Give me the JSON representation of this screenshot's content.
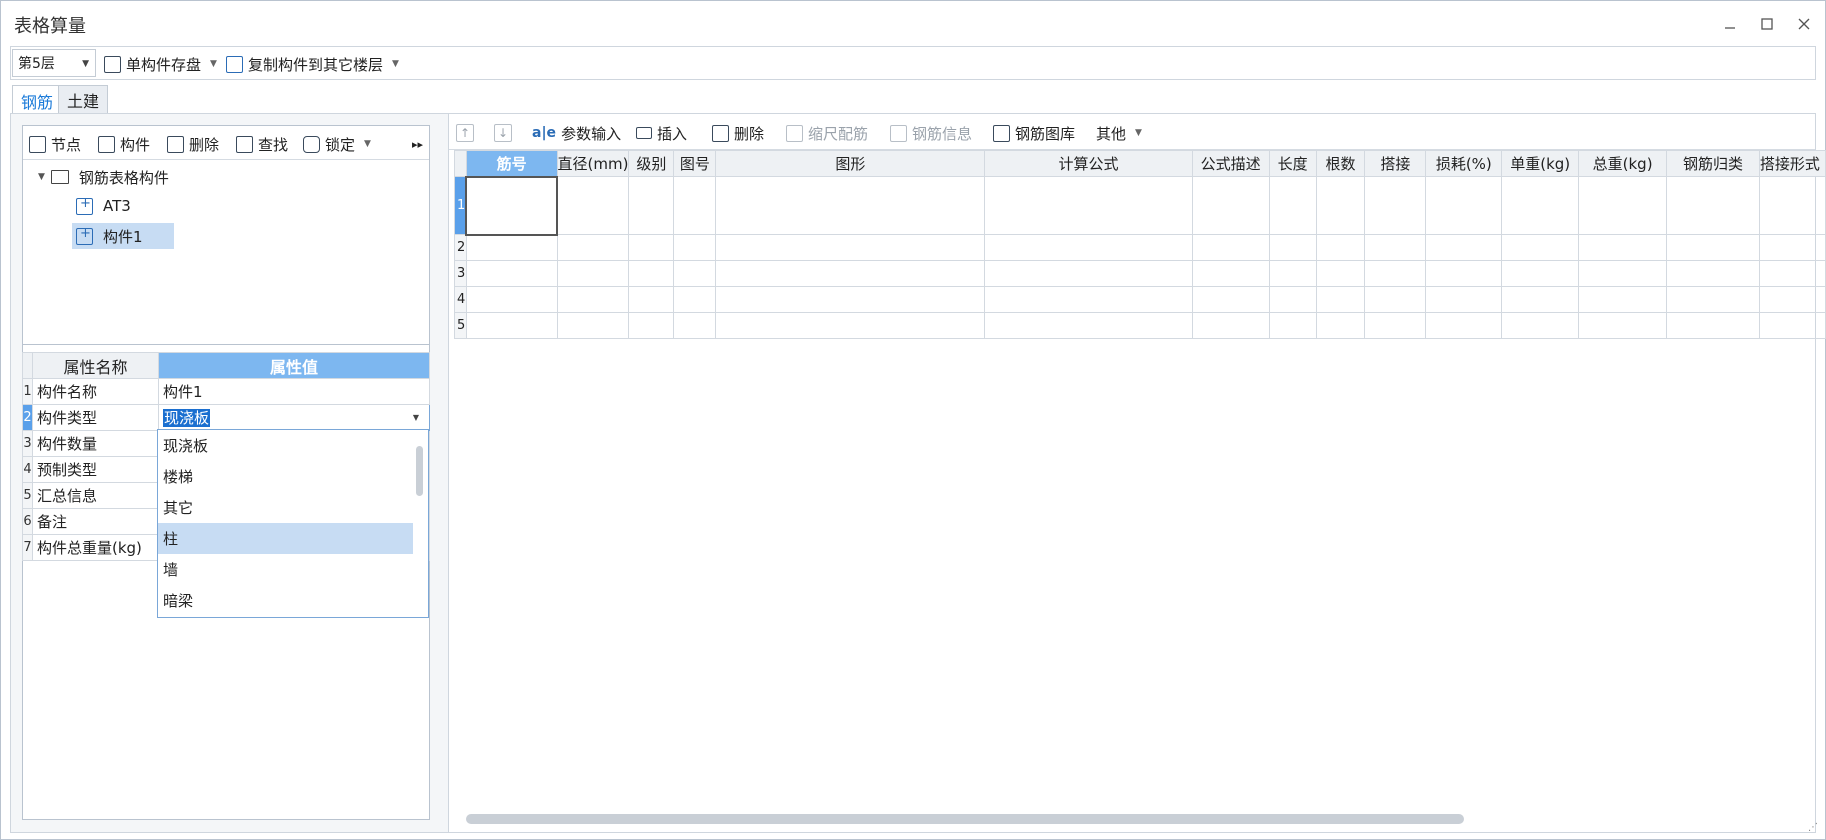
{
  "window": {
    "title": "表格算量",
    "minimize_icon": "minimize-icon",
    "maximize_icon": "maximize-icon",
    "close_icon": "close-icon"
  },
  "toolbar": {
    "floor_select": "第5层",
    "save_component": "单构件存盘",
    "copy_to_floors": "复制构件到其它楼层"
  },
  "tabs": [
    {
      "label": "钢筋",
      "active": true
    },
    {
      "label": "土建",
      "active": false
    }
  ],
  "left_toolbar": {
    "node": "节点",
    "component": "构件",
    "delete": "删除",
    "find": "查找",
    "lock": "锁定",
    "more": "▸▸"
  },
  "tree": {
    "root": "钢筋表格构件",
    "children": [
      {
        "label": "AT3",
        "selected": false
      },
      {
        "label": "构件1",
        "selected": true
      }
    ]
  },
  "properties": {
    "headers": [
      "属性名称",
      "属性值"
    ],
    "rows": [
      {
        "num": "1",
        "name": "构件名称",
        "value": "构件1"
      },
      {
        "num": "2",
        "name": "构件类型",
        "value": "现浇板"
      },
      {
        "num": "3",
        "name": "构件数量",
        "value": ""
      },
      {
        "num": "4",
        "name": "预制类型",
        "value": ""
      },
      {
        "num": "5",
        "name": "汇总信息",
        "value": ""
      },
      {
        "num": "6",
        "name": "备注",
        "value": ""
      },
      {
        "num": "7",
        "name": "构件总重量(kg)",
        "value": ""
      }
    ]
  },
  "type_dropdown": {
    "options": [
      "现浇板",
      "楼梯",
      "其它",
      "柱",
      "墙",
      "暗梁"
    ],
    "highlighted": "柱"
  },
  "right_toolbar": {
    "up": "↑",
    "down": "↓",
    "param_input": "参数输入",
    "insert": "插入",
    "delete": "删除",
    "scale_rebar": "缩尺配筋",
    "rebar_info": "钢筋信息",
    "rebar_library": "钢筋图库",
    "other": "其他"
  },
  "grid": {
    "headers": [
      "筋号",
      "直径(mm)",
      "级别",
      "图号",
      "图形",
      "计算公式",
      "公式描述",
      "长度",
      "根数",
      "搭接",
      "损耗(%)",
      "单重(kg)",
      "总重(kg)",
      "钢筋归类",
      "搭接形式"
    ],
    "row_numbers": [
      "1",
      "2",
      "3",
      "4",
      "5"
    ]
  }
}
